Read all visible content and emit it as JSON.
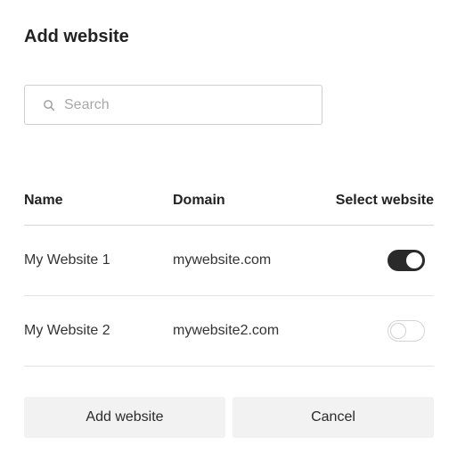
{
  "dialog": {
    "title": "Add website"
  },
  "search": {
    "placeholder": "Search",
    "value": ""
  },
  "table": {
    "columns": [
      "Name",
      "Domain",
      "Select website"
    ],
    "rows": [
      {
        "name": "My Website 1",
        "domain": "mywebsite.com",
        "selected": true
      },
      {
        "name": "My Website 2",
        "domain": "mywebsite2.com",
        "selected": false
      }
    ]
  },
  "actions": {
    "add_label": "Add website",
    "cancel_label": "Cancel"
  },
  "icons": {
    "search": "search-icon"
  },
  "colors": {
    "toggle_on": "#2a2a2a",
    "button_bg": "#f2f2f2"
  }
}
